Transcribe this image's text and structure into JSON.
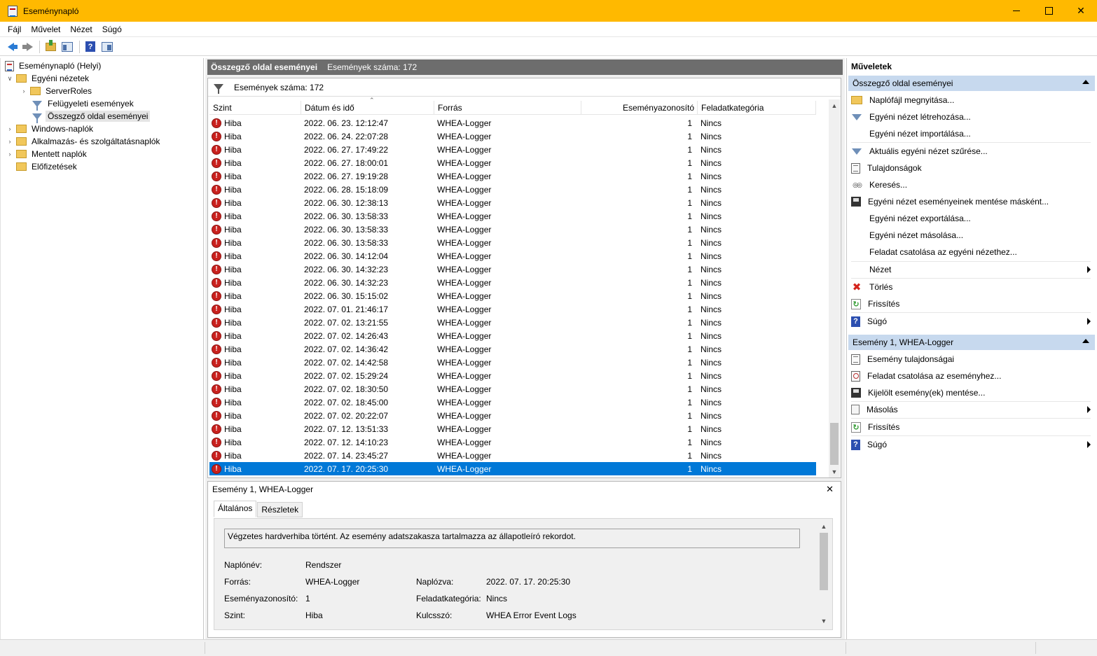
{
  "window": {
    "title": "Eseménynapló"
  },
  "menu": [
    "Fájl",
    "Művelet",
    "Nézet",
    "Súgó"
  ],
  "tree": {
    "root": "Eseménynapló (Helyi)",
    "custom_views": "Egyéni nézetek",
    "server_roles": "ServerRoles",
    "admin_events": "Felügyeleti események",
    "summary_events": "Összegző oldal eseményei",
    "windows_logs": "Windows-naplók",
    "app_logs": "Alkalmazás- és szolgáltatásnaplók",
    "saved_logs": "Mentett naplók",
    "subscriptions": "Előfizetések"
  },
  "center": {
    "header_title": "Összegző oldal eseményei",
    "header_count": "Események száma: 172",
    "filter_count": "Események száma: 172",
    "columns": [
      "Szint",
      "Dátum és idő",
      "Forrás",
      "Eseményazonosító",
      "Feladatkategória"
    ],
    "rows": [
      {
        "level": "Hiba",
        "date": "2022. 06. 23. 12:12:47",
        "source": "WHEA-Logger",
        "id": "1",
        "category": "Nincs"
      },
      {
        "level": "Hiba",
        "date": "2022. 06. 24. 22:07:28",
        "source": "WHEA-Logger",
        "id": "1",
        "category": "Nincs"
      },
      {
        "level": "Hiba",
        "date": "2022. 06. 27. 17:49:22",
        "source": "WHEA-Logger",
        "id": "1",
        "category": "Nincs"
      },
      {
        "level": "Hiba",
        "date": "2022. 06. 27. 18:00:01",
        "source": "WHEA-Logger",
        "id": "1",
        "category": "Nincs"
      },
      {
        "level": "Hiba",
        "date": "2022. 06. 27. 19:19:28",
        "source": "WHEA-Logger",
        "id": "1",
        "category": "Nincs"
      },
      {
        "level": "Hiba",
        "date": "2022. 06. 28. 15:18:09",
        "source": "WHEA-Logger",
        "id": "1",
        "category": "Nincs"
      },
      {
        "level": "Hiba",
        "date": "2022. 06. 30. 12:38:13",
        "source": "WHEA-Logger",
        "id": "1",
        "category": "Nincs"
      },
      {
        "level": "Hiba",
        "date": "2022. 06. 30. 13:58:33",
        "source": "WHEA-Logger",
        "id": "1",
        "category": "Nincs"
      },
      {
        "level": "Hiba",
        "date": "2022. 06. 30. 13:58:33",
        "source": "WHEA-Logger",
        "id": "1",
        "category": "Nincs"
      },
      {
        "level": "Hiba",
        "date": "2022. 06. 30. 13:58:33",
        "source": "WHEA-Logger",
        "id": "1",
        "category": "Nincs"
      },
      {
        "level": "Hiba",
        "date": "2022. 06. 30. 14:12:04",
        "source": "WHEA-Logger",
        "id": "1",
        "category": "Nincs"
      },
      {
        "level": "Hiba",
        "date": "2022. 06. 30. 14:32:23",
        "source": "WHEA-Logger",
        "id": "1",
        "category": "Nincs"
      },
      {
        "level": "Hiba",
        "date": "2022. 06. 30. 14:32:23",
        "source": "WHEA-Logger",
        "id": "1",
        "category": "Nincs"
      },
      {
        "level": "Hiba",
        "date": "2022. 06. 30. 15:15:02",
        "source": "WHEA-Logger",
        "id": "1",
        "category": "Nincs"
      },
      {
        "level": "Hiba",
        "date": "2022. 07. 01. 21:46:17",
        "source": "WHEA-Logger",
        "id": "1",
        "category": "Nincs"
      },
      {
        "level": "Hiba",
        "date": "2022. 07. 02. 13:21:55",
        "source": "WHEA-Logger",
        "id": "1",
        "category": "Nincs"
      },
      {
        "level": "Hiba",
        "date": "2022. 07. 02. 14:26:43",
        "source": "WHEA-Logger",
        "id": "1",
        "category": "Nincs"
      },
      {
        "level": "Hiba",
        "date": "2022. 07. 02. 14:36:42",
        "source": "WHEA-Logger",
        "id": "1",
        "category": "Nincs"
      },
      {
        "level": "Hiba",
        "date": "2022. 07. 02. 14:42:58",
        "source": "WHEA-Logger",
        "id": "1",
        "category": "Nincs"
      },
      {
        "level": "Hiba",
        "date": "2022. 07. 02. 15:29:24",
        "source": "WHEA-Logger",
        "id": "1",
        "category": "Nincs"
      },
      {
        "level": "Hiba",
        "date": "2022. 07. 02. 18:30:50",
        "source": "WHEA-Logger",
        "id": "1",
        "category": "Nincs"
      },
      {
        "level": "Hiba",
        "date": "2022. 07. 02. 18:45:00",
        "source": "WHEA-Logger",
        "id": "1",
        "category": "Nincs"
      },
      {
        "level": "Hiba",
        "date": "2022. 07. 02. 20:22:07",
        "source": "WHEA-Logger",
        "id": "1",
        "category": "Nincs"
      },
      {
        "level": "Hiba",
        "date": "2022. 07. 12. 13:51:33",
        "source": "WHEA-Logger",
        "id": "1",
        "category": "Nincs"
      },
      {
        "level": "Hiba",
        "date": "2022. 07. 12. 14:10:23",
        "source": "WHEA-Logger",
        "id": "1",
        "category": "Nincs"
      },
      {
        "level": "Hiba",
        "date": "2022. 07. 14. 23:45:27",
        "source": "WHEA-Logger",
        "id": "1",
        "category": "Nincs"
      },
      {
        "level": "Hiba",
        "date": "2022. 07. 17. 20:25:30",
        "source": "WHEA-Logger",
        "id": "1",
        "category": "Nincs",
        "selected": true
      }
    ]
  },
  "detail": {
    "title": "Esemény 1, WHEA-Logger",
    "tab_general": "Általános",
    "tab_details": "Részletek",
    "description": "Végzetes hardverhiba történt. Az esemény adatszakasza tartalmazza az állapotleíró rekordot.",
    "log_name_label": "Naplónév:",
    "log_name": "Rendszer",
    "source_label": "Forrás:",
    "source": "WHEA-Logger",
    "logged_label": "Naplózva:",
    "logged": "2022. 07. 17. 20:25:30",
    "event_id_label": "Eseményazonosító:",
    "event_id": "1",
    "task_cat_label": "Feladatkategória:",
    "task_cat": "Nincs",
    "level_label": "Szint:",
    "level": "Hiba",
    "keywords_label": "Kulcsszó:",
    "keywords": "WHEA Error Event Logs"
  },
  "actions": {
    "title": "Műveletek",
    "section1": "Összegző oldal eseményei",
    "open_log": "Naplófájl megnyitása...",
    "create_view": "Egyéni nézet létrehozása...",
    "import_view": "Egyéni nézet importálása...",
    "filter_view": "Aktuális egyéni nézet szűrése...",
    "properties": "Tulajdonságok",
    "find": "Keresés...",
    "save_events": "Egyéni nézet eseményeinek mentése másként...",
    "export_view": "Egyéni nézet exportálása...",
    "copy_view": "Egyéni nézet másolása...",
    "attach_task_view": "Feladat csatolása az egyéni nézethez...",
    "view": "Nézet",
    "delete": "Törlés",
    "refresh": "Frissítés",
    "help": "Súgó",
    "section2": "Esemény 1, WHEA-Logger",
    "event_props": "Esemény tulajdonságai",
    "attach_task_event": "Feladat csatolása az eseményhez...",
    "save_selected": "Kijelölt esemény(ek) mentése...",
    "copy": "Másolás",
    "refresh2": "Frissítés",
    "help2": "Súgó"
  },
  "colors": {
    "titlebar": "#ffb900",
    "selection": "#0078d7",
    "section_header": "#c7d9ee",
    "error_icon": "#c9211e"
  }
}
